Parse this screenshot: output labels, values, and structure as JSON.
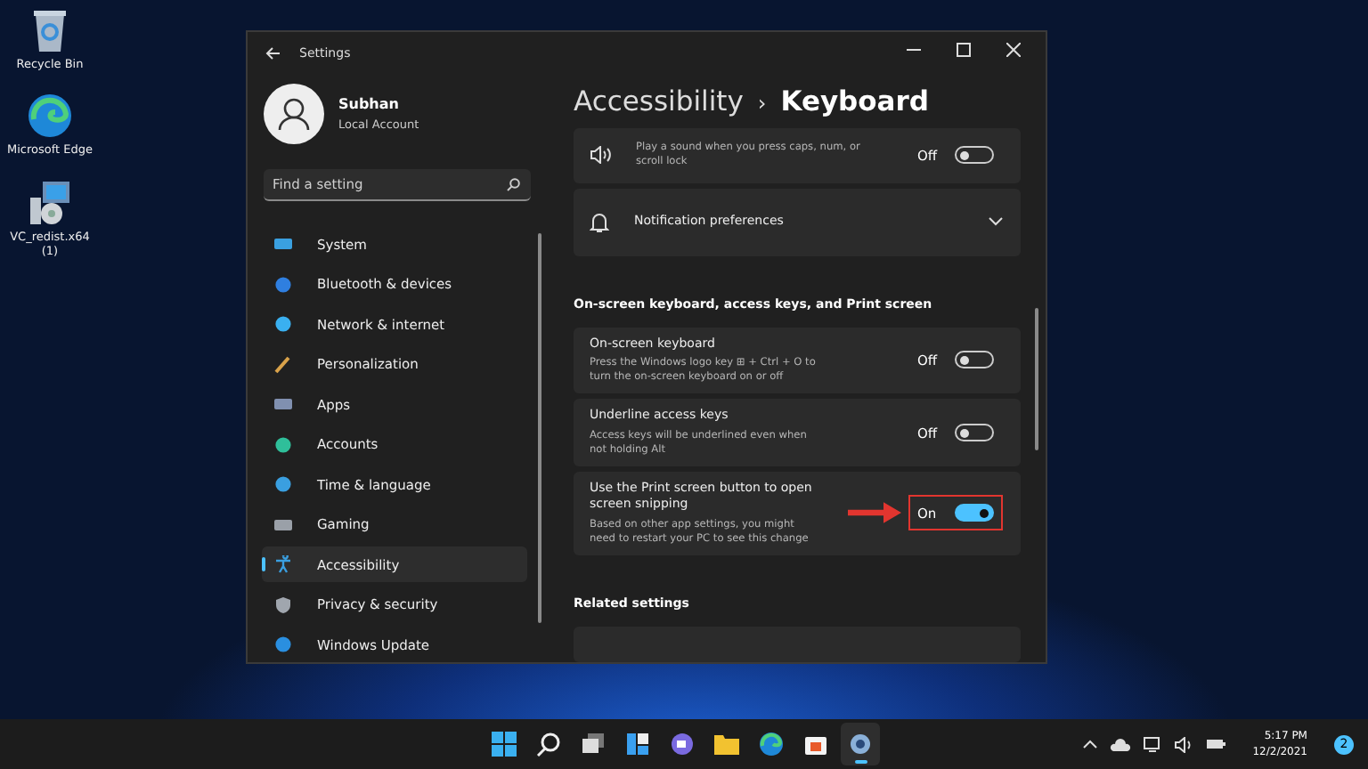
{
  "desktop_icons": [
    {
      "kind": "bin",
      "label": "Recycle Bin"
    },
    {
      "kind": "edge",
      "label": "Microsoft Edge"
    },
    {
      "kind": "installer",
      "label": "VC_redist.x64 (1)"
    }
  ],
  "window": {
    "title": "Settings"
  },
  "user": {
    "name": "Subhan",
    "account": "Local Account"
  },
  "search": {
    "placeholder": "Find a setting"
  },
  "nav": [
    {
      "kind": "system",
      "label": "System",
      "selected": false
    },
    {
      "kind": "bluetooth",
      "label": "Bluetooth & devices",
      "selected": false
    },
    {
      "kind": "network",
      "label": "Network & internet",
      "selected": false
    },
    {
      "kind": "brush",
      "label": "Personalization",
      "selected": false
    },
    {
      "kind": "apps",
      "label": "Apps",
      "selected": false
    },
    {
      "kind": "accounts",
      "label": "Accounts",
      "selected": false
    },
    {
      "kind": "time",
      "label": "Time & language",
      "selected": false
    },
    {
      "kind": "gaming",
      "label": "Gaming",
      "selected": false
    },
    {
      "kind": "accessibility",
      "label": "Accessibility",
      "selected": true
    },
    {
      "kind": "shield",
      "label": "Privacy & security",
      "selected": false
    },
    {
      "kind": "update",
      "label": "Windows Update",
      "selected": false
    }
  ],
  "breadcrumb": {
    "parent": "Accessibility",
    "separator": "›",
    "current": "Keyboard"
  },
  "settings": [
    {
      "kind": "toggle",
      "description": "Play a sound when you press caps, num, or scroll lock",
      "state_label": "Off",
      "on": false,
      "highlighted": false
    },
    {
      "kind": "expander",
      "title": "Notification preferences"
    },
    {
      "kind": "heading",
      "title": "On-screen keyboard, access keys, and Print screen"
    },
    {
      "kind": "toggle",
      "title": "On-screen keyboard",
      "description": "Press the Windows logo key ⊞ + Ctrl + O to turn the on-screen keyboard on or off",
      "state_label": "Off",
      "on": false,
      "highlighted": false
    },
    {
      "kind": "toggle",
      "title": "Underline access keys",
      "description": "Access keys will be underlined even when not holding Alt",
      "state_label": "Off",
      "on": false,
      "highlighted": false
    },
    {
      "kind": "toggle",
      "title": "Use the Print screen button to open screen snipping",
      "description": "Based on other app settings, you might need to restart your PC to see this change",
      "state_label": "On",
      "on": true,
      "highlighted": true
    },
    {
      "kind": "heading",
      "title": "Related settings"
    },
    {
      "kind": "blank"
    }
  ],
  "taskbar": {
    "apps": [
      {
        "kind": "start",
        "selected": false
      },
      {
        "kind": "search",
        "selected": false
      },
      {
        "kind": "taskview",
        "selected": false
      },
      {
        "kind": "widgets",
        "selected": false
      },
      {
        "kind": "chat",
        "selected": false
      },
      {
        "kind": "folder",
        "selected": false
      },
      {
        "kind": "edge",
        "selected": false
      },
      {
        "kind": "store",
        "selected": false
      },
      {
        "kind": "settings",
        "selected": true
      }
    ],
    "time": "5:17 PM",
    "date": "12/2/2021",
    "notifications": "2"
  }
}
